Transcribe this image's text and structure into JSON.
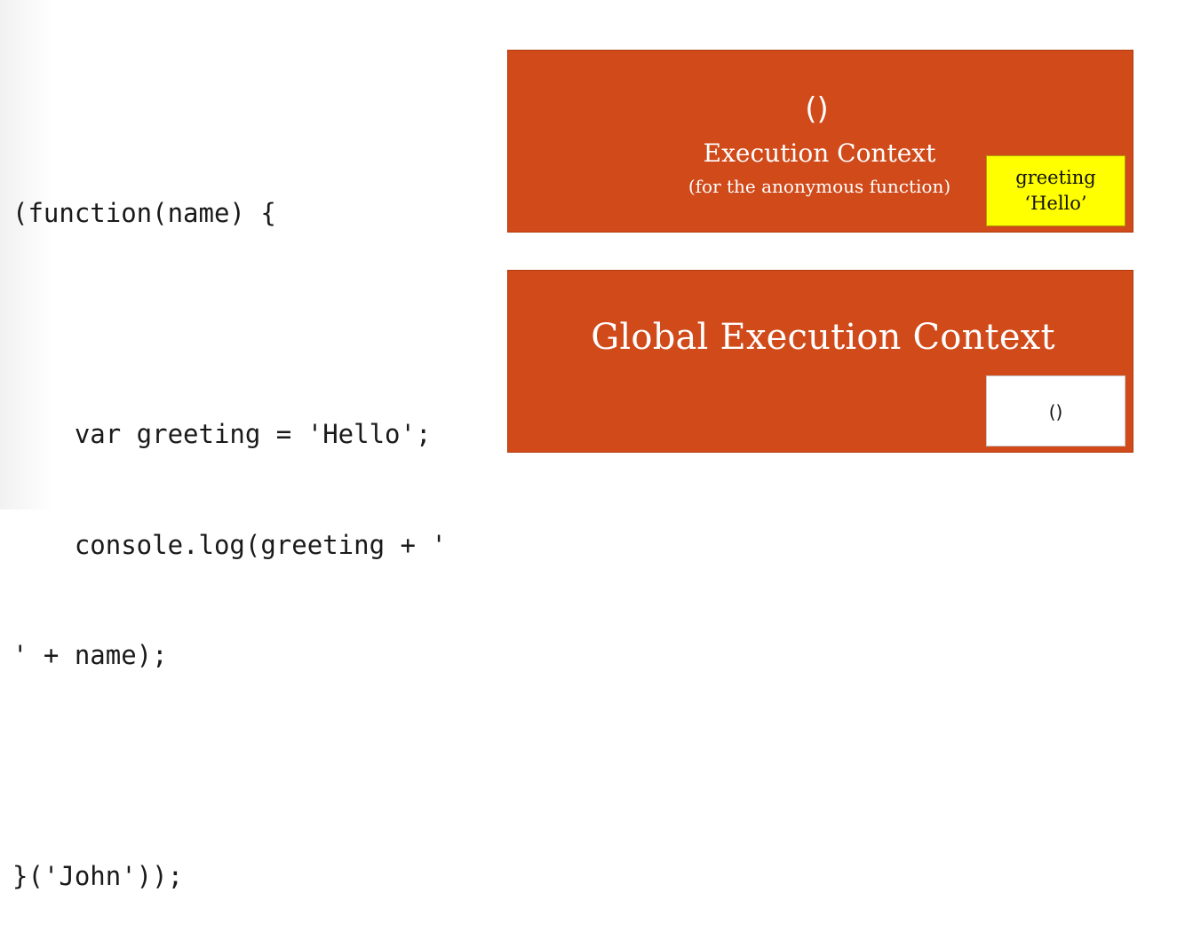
{
  "code": {
    "lines": [
      "(function(name) {",
      "",
      "    var greeting = 'Hello';",
      "    console.log(greeting + '",
      "' + name);",
      "",
      "}('John'));"
    ]
  },
  "anon_context": {
    "symbol": "()",
    "title": "Execution Context",
    "subtitle": "(for the anonymous function)",
    "variable": {
      "name": "greeting",
      "value": "‘Hello’"
    }
  },
  "global_context": {
    "title": "Global Execution Context",
    "function_ref": "()"
  },
  "colors": {
    "context_fill": "#d04a1a",
    "variable_fill": "#ffff00",
    "function_fill": "#ffffff"
  }
}
